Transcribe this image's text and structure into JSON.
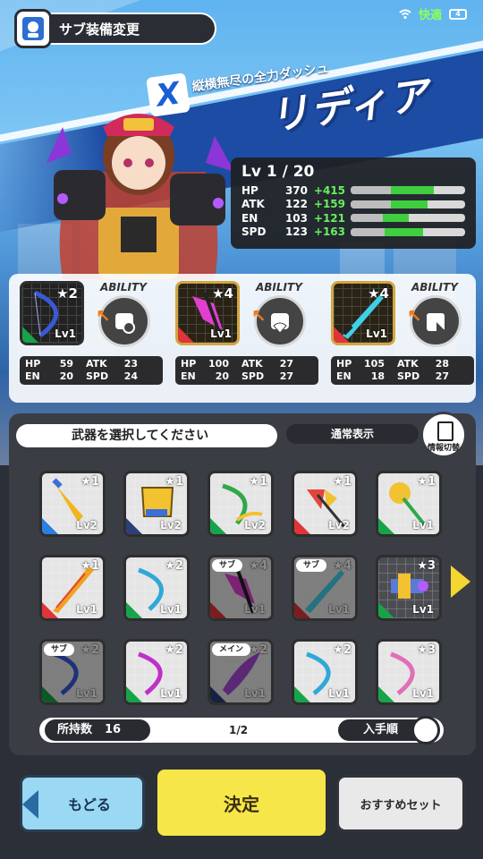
{
  "status_bar": {
    "network": "快適",
    "battery": "4"
  },
  "header": {
    "title": "サブ装備変更"
  },
  "character": {
    "catchphrase": "縦横無尽の全力ダッシュ",
    "name": "リディア"
  },
  "stats": {
    "level": "Lv 1 / 20",
    "rows": [
      {
        "key": "HP",
        "value": "370",
        "bonus": "+415",
        "base_fill": 0.35,
        "bonus_fill": 0.38
      },
      {
        "key": "ATK",
        "value": "122",
        "bonus": "+159",
        "base_fill": 0.35,
        "bonus_fill": 0.32
      },
      {
        "key": "EN",
        "value": "103",
        "bonus": "+121",
        "base_fill": 0.28,
        "bonus_fill": 0.23
      },
      {
        "key": "SPD",
        "value": "123",
        "bonus": "+163",
        "base_fill": 0.3,
        "bonus_fill": 0.33
      }
    ]
  },
  "equipped": [
    {
      "stars": "★2",
      "level": "Lv1",
      "ability_label": "ABILITY",
      "stats": {
        "hp": "59",
        "atk": "23",
        "en": "20",
        "spd": "24"
      }
    },
    {
      "stars": "★4",
      "level": "Lv1",
      "ability_label": "ABILITY",
      "stats": {
        "hp": "100",
        "atk": "27",
        "en": "20",
        "spd": "27"
      }
    },
    {
      "stars": "★4",
      "level": "Lv1",
      "ability_label": "ABILITY",
      "stats": {
        "hp": "105",
        "atk": "28",
        "en": "18",
        "spd": "27"
      }
    }
  ],
  "stat_labels": {
    "hp": "HP",
    "atk": "ATK",
    "en": "EN",
    "spd": "SPD"
  },
  "selection": {
    "heading": "武器を選択してください",
    "view_mode": "通常表示",
    "switch_label": "情報切替",
    "items": [
      {
        "stars": "★1",
        "level": "Lv2",
        "tag": ""
      },
      {
        "stars": "★1",
        "level": "Lv2",
        "tag": ""
      },
      {
        "stars": "★1",
        "level": "Lv2",
        "tag": ""
      },
      {
        "stars": "★1",
        "level": "Lv2",
        "tag": ""
      },
      {
        "stars": "★1",
        "level": "Lv1",
        "tag": ""
      },
      {
        "stars": "★1",
        "level": "Lv1",
        "tag": ""
      },
      {
        "stars": "★2",
        "level": "Lv1",
        "tag": ""
      },
      {
        "stars": "★4",
        "level": "Lv1",
        "tag": "サブ"
      },
      {
        "stars": "★4",
        "level": "Lv1",
        "tag": "サブ"
      },
      {
        "stars": "★3",
        "level": "Lv1",
        "tag": ""
      },
      {
        "stars": "★2",
        "level": "Lv1",
        "tag": "サブ"
      },
      {
        "stars": "★2",
        "level": "Lv1",
        "tag": ""
      },
      {
        "stars": "★2",
        "level": "Lv1",
        "tag": "メイン"
      },
      {
        "stars": "★2",
        "level": "Lv1",
        "tag": ""
      },
      {
        "stars": "★3",
        "level": "Lv1",
        "tag": ""
      }
    ],
    "owned_label": "所持数",
    "owned_count": "16",
    "page": "1/2",
    "sort_label": "入手順"
  },
  "buttons": {
    "back": "もどる",
    "confirm": "決定",
    "recommend": "おすすめセット"
  },
  "colors": {
    "accent_green": "#69ef5e",
    "confirm_yellow": "#f6e64a",
    "back_blue": "#9bd8f3"
  }
}
